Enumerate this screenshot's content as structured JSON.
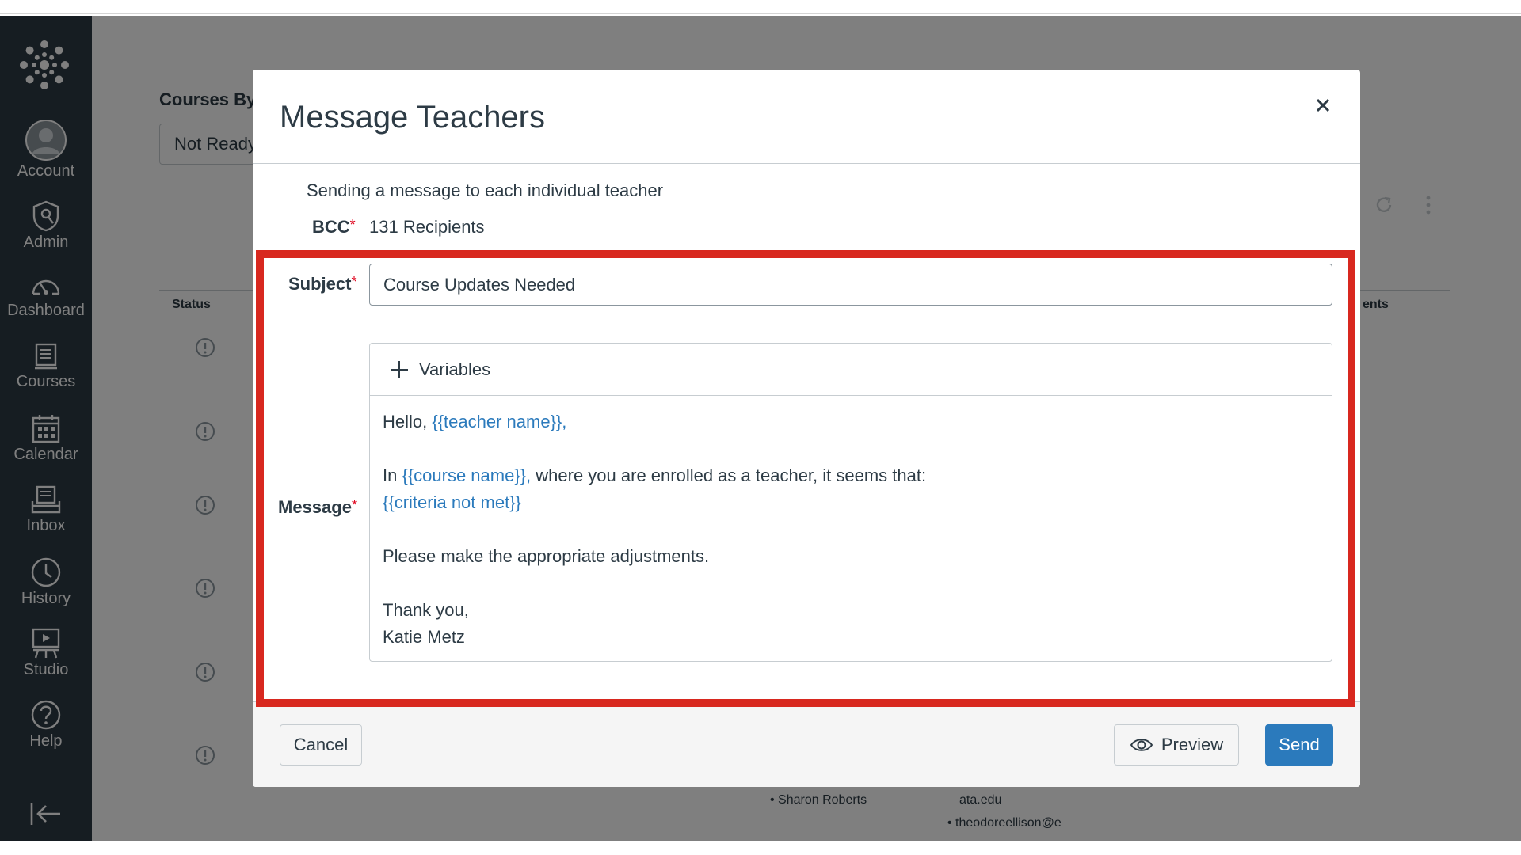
{
  "sidebar": {
    "items": [
      {
        "label": "Account",
        "icon": "user-avatar-icon"
      },
      {
        "label": "Admin",
        "icon": "admin-shield-icon"
      },
      {
        "label": "Dashboard",
        "icon": "dashboard-gauge-icon"
      },
      {
        "label": "Courses",
        "icon": "courses-book-icon"
      },
      {
        "label": "Calendar",
        "icon": "calendar-icon"
      },
      {
        "label": "Inbox",
        "icon": "inbox-icon"
      },
      {
        "label": "History",
        "icon": "clock-icon"
      },
      {
        "label": "Studio",
        "icon": "studio-icon"
      },
      {
        "label": "Help",
        "icon": "help-question-icon"
      }
    ],
    "colors": {
      "background": "#2d3b45",
      "text": "#ffffff"
    }
  },
  "background_page": {
    "section_title": "Courses By",
    "filter_value": "Not Ready",
    "col_status": "Status",
    "col_right": "ents",
    "names": [
      "Sharon Roberts"
    ],
    "emails": [
      "ata.edu",
      "theodoreellison@e"
    ]
  },
  "modal": {
    "title": "Message Teachers",
    "sending_text": "Sending a message to each individual teacher",
    "bcc_label": "BCC",
    "required_mark": "*",
    "bcc_value": "131 Recipients",
    "subject_label": "Subject",
    "subject_value": "Course Updates Needed",
    "message_label": "Message",
    "variables_label": "Variables",
    "message": {
      "l1_pre": "Hello, ",
      "l1_var": "{{teacher name}},",
      "l2_pre": "In ",
      "l2_var": "{{course name}},",
      "l2_post": " where you are enrolled as a teacher, it seems that:",
      "l3_var": "{{criteria not met}}",
      "l4": "Please make the appropriate adjustments.",
      "l5": "Thank you,",
      "l6": "Katie Metz"
    },
    "buttons": {
      "cancel": "Cancel",
      "preview": "Preview",
      "send": "Send"
    }
  },
  "colors": {
    "accent": "#2b7abc",
    "required": "#e0061f",
    "highlight_border": "#d8281f",
    "text": "#2d3b45"
  }
}
